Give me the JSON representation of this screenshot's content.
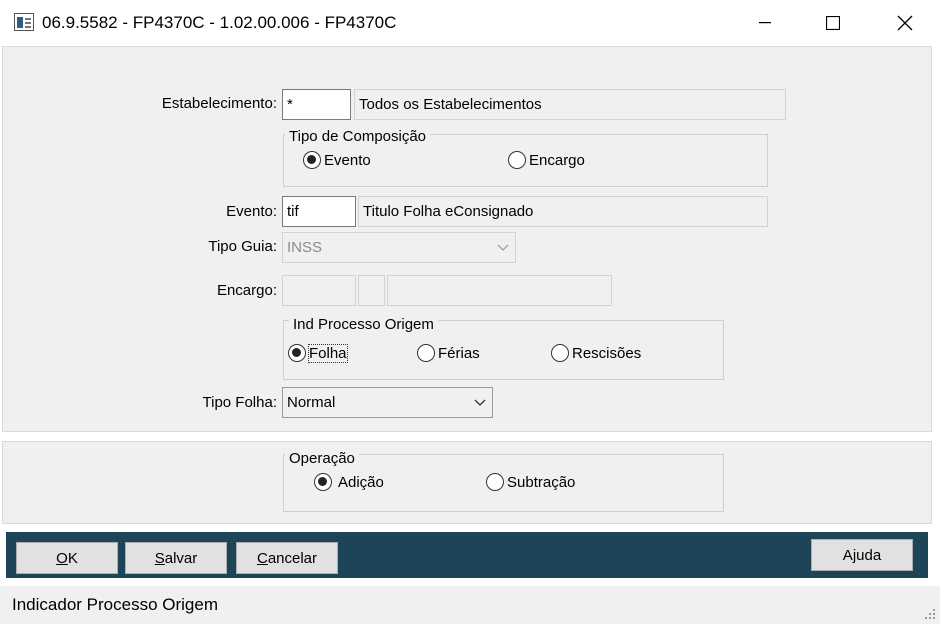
{
  "window": {
    "title": "06.9.5582 - FP4370C - 1.02.00.006 - FP4370C"
  },
  "form": {
    "estabelecimento": {
      "label": "Estabelecimento:",
      "code": "*",
      "description": "Todos os Estabelecimentos"
    },
    "tipo_composicao": {
      "title": "Tipo de Composição",
      "options": [
        {
          "label": "Evento",
          "selected": true
        },
        {
          "label": "Encargo",
          "selected": false
        }
      ]
    },
    "evento": {
      "label": "Evento:",
      "code": "tif",
      "description": "Titulo Folha  eConsignado"
    },
    "tipo_guia": {
      "label": "Tipo Guia:",
      "value": "INSS"
    },
    "encargo": {
      "label": "Encargo:",
      "code": "",
      "sub": "",
      "description": ""
    },
    "ind_processo_origem": {
      "title": "Ind Processo Origem",
      "options": [
        {
          "label": "Folha",
          "selected": true
        },
        {
          "label": "Férias",
          "selected": false
        },
        {
          "label": "Rescisões",
          "selected": false
        }
      ]
    },
    "tipo_folha": {
      "label": "Tipo Folha:",
      "value": "Normal"
    }
  },
  "operacao": {
    "title": "Operação",
    "options": [
      {
        "label": "Adição",
        "selected": true
      },
      {
        "label": "Subtração",
        "selected": false
      }
    ]
  },
  "buttons": {
    "ok": {
      "mnemonic": "O",
      "rest": "K"
    },
    "salvar": {
      "mnemonic": "S",
      "rest": "alvar"
    },
    "cancelar": {
      "mnemonic": "C",
      "rest": "ancelar"
    },
    "ajuda": {
      "pre": "A",
      "mnemonic": "j",
      "rest": "uda"
    }
  },
  "status": {
    "text": "Indicador Processo Origem"
  },
  "colors": {
    "button_bar": "#1d4557",
    "panel": "#f0f0f0"
  },
  "icons": [
    "app-icon",
    "minimize-icon",
    "maximize-icon",
    "close-icon",
    "chevron-down-icon",
    "size-grip-icon"
  ]
}
